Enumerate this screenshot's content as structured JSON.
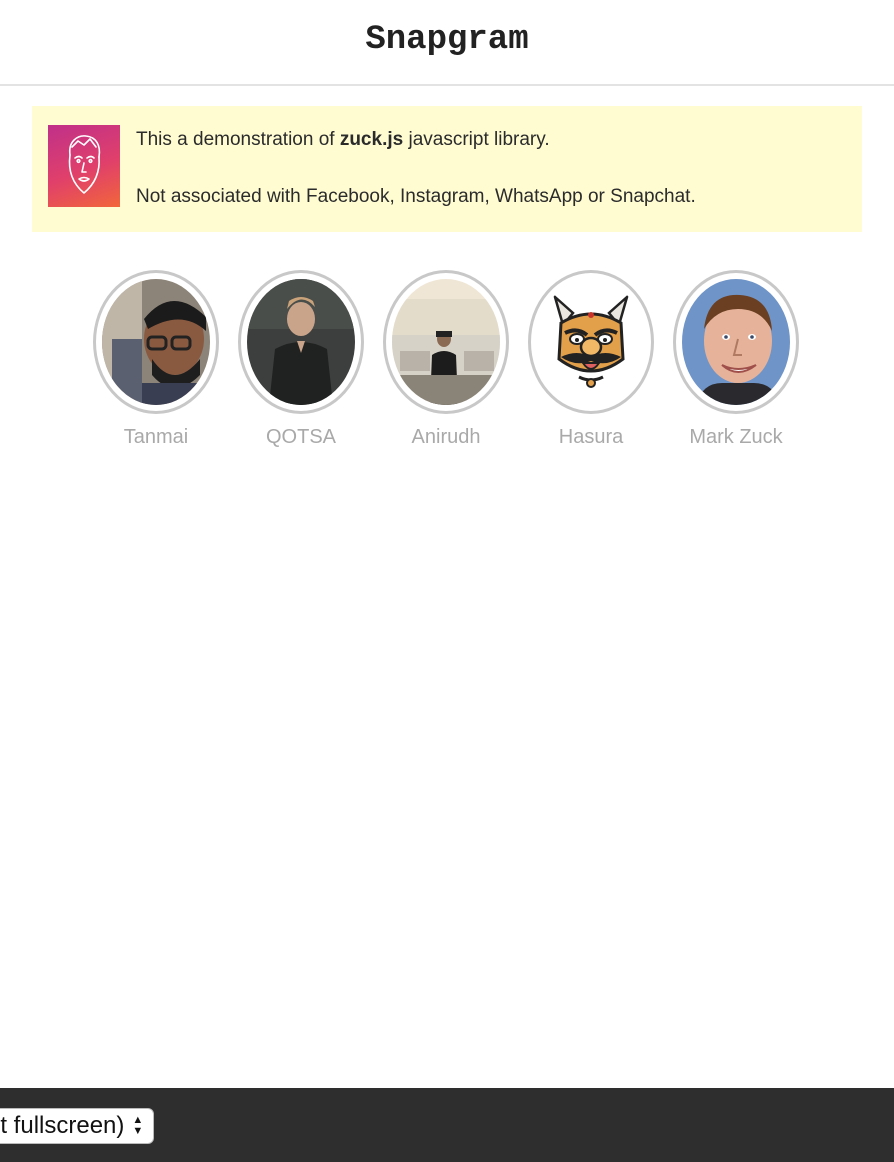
{
  "header": {
    "title": "Snapgram"
  },
  "notice": {
    "line1_prefix": "This a demonstration of ",
    "line1_bold": "zuck.js",
    "line1_suffix": " javascript library.",
    "line2": "Not associated with Facebook, Instagram, WhatsApp or Snapchat."
  },
  "stories": [
    {
      "name": "Tanmai"
    },
    {
      "name": "QOTSA"
    },
    {
      "name": "Anirudh"
    },
    {
      "name": "Hasura"
    },
    {
      "name": "Mark Zuck"
    }
  ],
  "footer": {
    "mode_select_value": "ut fullscreen)"
  },
  "colors": {
    "notice_bg": "#fffcd2",
    "bottom_bar": "#2e2e2e",
    "story_ring": "#c8c8c8",
    "story_name": "#a9a9a9"
  }
}
